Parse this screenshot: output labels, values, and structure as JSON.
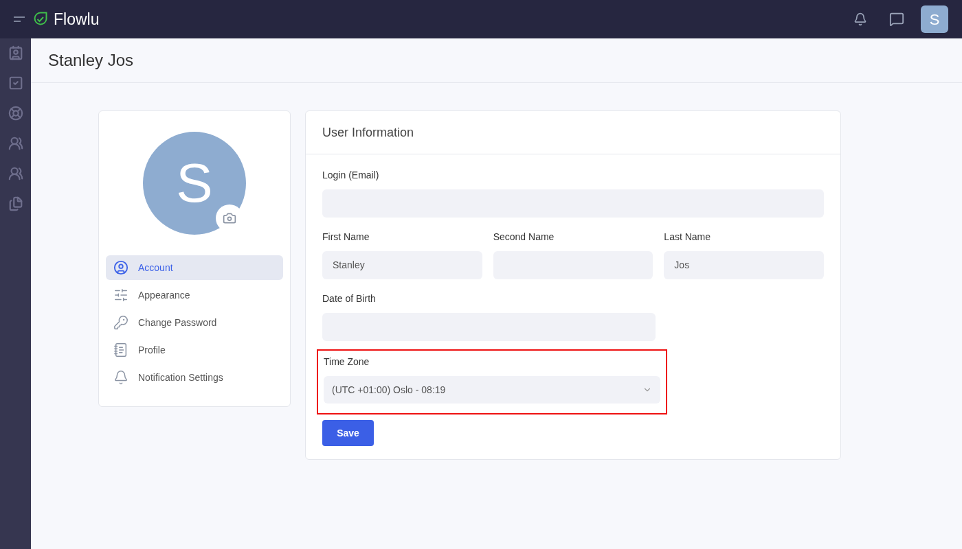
{
  "topbar": {
    "brand": "Flowlu",
    "avatar_letter": "S"
  },
  "rail": {
    "items": [
      {
        "kind": "contacts"
      },
      {
        "kind": "tasks"
      },
      {
        "kind": "support"
      },
      {
        "kind": "team"
      },
      {
        "kind": "team"
      },
      {
        "kind": "documents"
      }
    ]
  },
  "page": {
    "title": "Stanley Jos"
  },
  "profile_card": {
    "avatar_letter": "S",
    "menu": [
      {
        "kind": "account",
        "label": "Account",
        "selected": true
      },
      {
        "kind": "appearance",
        "label": "Appearance",
        "selected": false
      },
      {
        "kind": "password",
        "label": "Change Password",
        "selected": false
      },
      {
        "kind": "profile",
        "label": "Profile",
        "selected": false
      },
      {
        "kind": "notifications",
        "label": "Notification Settings",
        "selected": false
      }
    ]
  },
  "user_info": {
    "title": "User Information",
    "login": {
      "label": "Login (Email)"
    },
    "names": [
      {
        "label": "First Name",
        "value": "Stanley"
      },
      {
        "label": "Second Name"
      },
      {
        "label": "Last Name",
        "value": "Jos"
      }
    ],
    "date_of_birth": {
      "label": "Date of Birth"
    },
    "time_zone": {
      "label": "Time Zone",
      "value": "(UTC +01:00) Oslo - 08:19",
      "highlighted": true
    },
    "save_button": "Save"
  }
}
